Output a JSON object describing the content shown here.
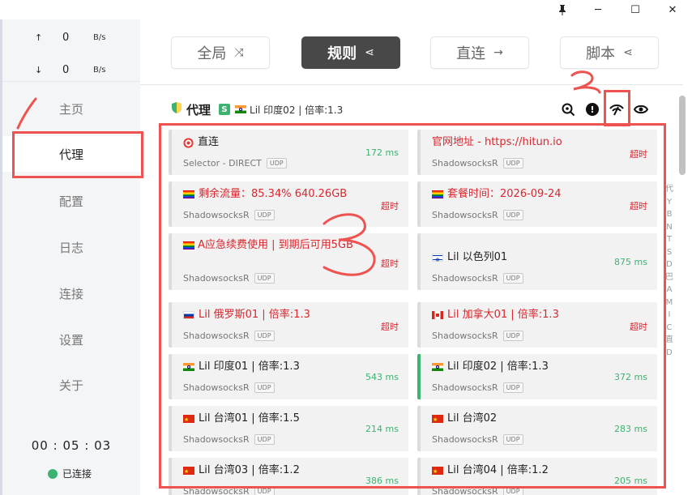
{
  "window": {
    "pin_icon": "pin-icon",
    "minimize_glyph": "─",
    "maximize_glyph": "☐",
    "close_glyph": "✕"
  },
  "traffic": {
    "upload_arrow": "↑",
    "upload_value": "0",
    "upload_unit": "B/s",
    "download_arrow": "↓",
    "download_value": "0",
    "download_unit": "B/s"
  },
  "nav": {
    "home": "主页",
    "proxy": "代理",
    "profiles": "配置",
    "logs": "日志",
    "connections": "连接",
    "settings": "设置",
    "about": "关于"
  },
  "status": {
    "timer": "00 : 05 : 03",
    "connected": "已连接",
    "color": "#3cb371"
  },
  "modes": {
    "global": "全局",
    "rule": "规则",
    "direct": "直连",
    "script": "脚本"
  },
  "group": {
    "title": "代理",
    "badge": "S",
    "current": "Lil 印度02 | 倍率:1.3"
  },
  "proxies": [
    {
      "name": "直连",
      "type": "Selector - DIRECT",
      "udp": "UDP",
      "delay": "172 ms"
    },
    {
      "name": "官网地址 - https://hitun.io",
      "type": "ShadowsocksR",
      "udp": "UDP",
      "delay": "超时"
    },
    {
      "name": "剩余流量：85.34% 640.26GB",
      "type": "ShadowsocksR",
      "udp": "UDP",
      "delay": "超时"
    },
    {
      "name": "套餐时间：2026-09-24",
      "type": "ShadowsocksR",
      "udp": "UDP",
      "delay": "超时"
    },
    {
      "name": "A应急续费使用 | 到期后可用5GB",
      "type": "ShadowsocksR",
      "udp": "UDP",
      "delay": "超时"
    },
    {
      "name": "Lil 以色列01",
      "type": "ShadowsocksR",
      "udp": "UDP",
      "delay": "875 ms"
    },
    {
      "name": "Lil 俄罗斯01 | 倍率:1.3",
      "type": "ShadowsocksR",
      "udp": "UDP",
      "delay": "超时"
    },
    {
      "name": "Lil 加拿大01 | 倍率:1.3",
      "type": "ShadowsocksR",
      "udp": "UDP",
      "delay": "超时"
    },
    {
      "name": "Lil 印度01 | 倍率:1.3",
      "type": "ShadowsocksR",
      "udp": "UDP",
      "delay": "543 ms"
    },
    {
      "name": "Lil 印度02 | 倍率:1.3",
      "type": "ShadowsocksR",
      "udp": "UDP",
      "delay": "372 ms"
    },
    {
      "name": "Lil 台湾01 | 倍率:1.5",
      "type": "ShadowsocksR",
      "udp": "UDP",
      "delay": "214 ms"
    },
    {
      "name": "Lil 台湾02",
      "type": "ShadowsocksR",
      "udp": "UDP",
      "delay": "283 ms"
    },
    {
      "name": "Lil 台湾03 | 倍率:1.2",
      "type": "ShadowsocksR",
      "udp": "UDP",
      "delay": "386 ms"
    },
    {
      "name": "Lil 台湾04 | 倍率:1.2",
      "type": "ShadowsocksR",
      "udp": "UDP",
      "delay": "205 ms"
    }
  ],
  "alpha_index": "代\nY\nB\nN\nT\nS\nD\n巴\nA\nM\nI\nC\n直\nD",
  "colors": {
    "ok": "#3cb371",
    "timeout": "#d9272e",
    "annotation": "#ef5350"
  }
}
